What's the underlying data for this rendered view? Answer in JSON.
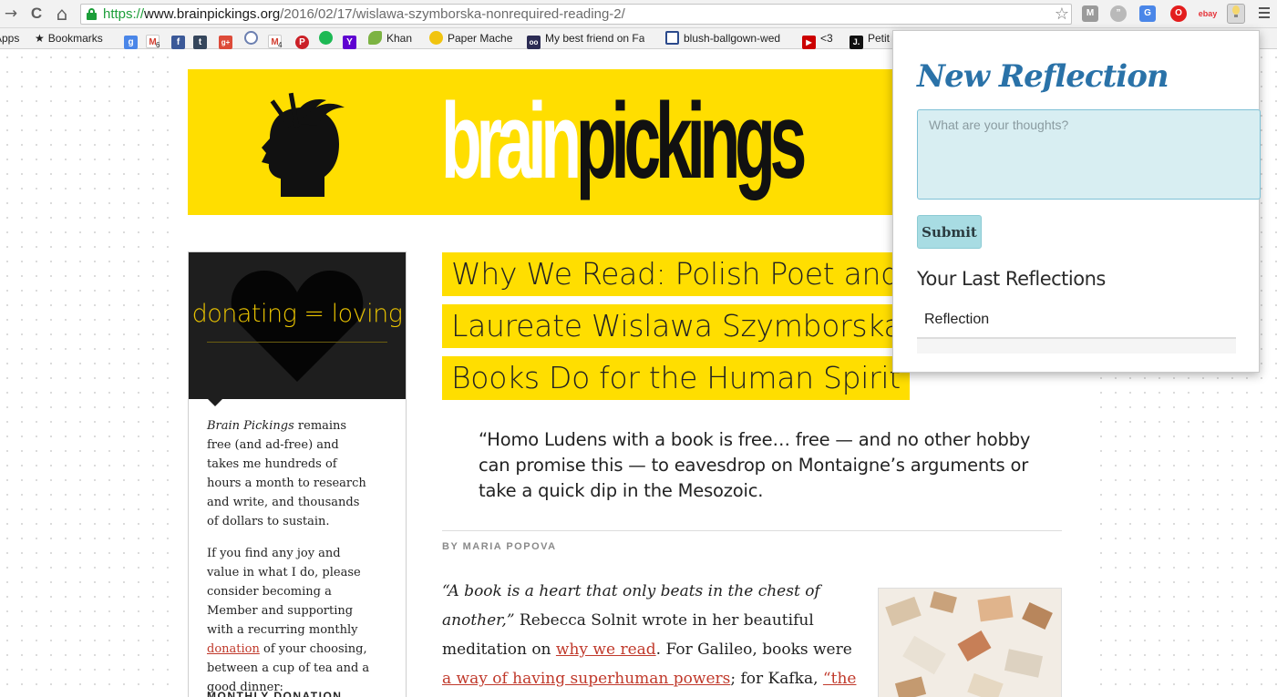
{
  "browser": {
    "url_scheme": "https://",
    "url_host": "www.brainpickings.org",
    "url_path": "/2016/02/17/wislawa-szymborska-nonrequired-reading-2/",
    "nav": {
      "forward": "→",
      "reload": "C",
      "home": "⌂"
    },
    "star": "☆"
  },
  "bookmarks": {
    "apps": "Apps",
    "items": [
      {
        "label": "Bookmarks"
      },
      {
        "label": "Khan"
      },
      {
        "label": "Paper Mache"
      },
      {
        "label": "My best friend on Fa"
      },
      {
        "label": "blush-ballgown-wed"
      },
      {
        "label": "<3"
      },
      {
        "label": "Petit"
      }
    ],
    "badges": {
      "gmail_count": "6",
      "gmail2_count": "4"
    },
    "icon_letters": {
      "google": "g",
      "facebook": "f",
      "tumblr": "t",
      "googleplus": "g+",
      "yahoo": "Y",
      "khan": "",
      "oo": "oo",
      "youtube": "▶",
      "j": "J."
    }
  },
  "banner": {
    "word_brain": "brain",
    "word_pickings": "pickings"
  },
  "donate": {
    "heading": "donating = loving",
    "para1_em": "Brain Pickings",
    "para1_rest": " remains free (and ad-free) and takes me hundreds of hours a month to research and write, and thousands of dollars to sustain.",
    "para2_before": "If you find any joy and value in what I do, please consider becoming a Member and supporting with a recurring monthly ",
    "para2_link": "donation",
    "para2_after": " of your choosing, between a cup of tea and a good dinner:",
    "monthly_label": "MONTHLY DONATION"
  },
  "article": {
    "title_lines": [
      "Why We Read: Polish Poet and",
      "Laureate Wislawa Szymborska",
      "Books Do for the Human Spirit"
    ],
    "pull_quote": "“Homo Ludens with a book is free… free — and no other hobby can promise this — to eavesdrop on Montaigne’s arguments or take a quick dip in the Mesozoic.",
    "byline": "BY MARIA POPOVA",
    "body_em": "“A book is a heart that only beats in the chest of another,”",
    "body_1": " Rebecca Solnit wrote in her beautiful meditation on ",
    "link_1": "why we read",
    "body_2": ". For Galileo, books were ",
    "link_2": "a way of having superhuman powers",
    "body_3": "; for Kafka, ",
    "link_3": "“the axe for the frozen"
  },
  "popup": {
    "title": "New Reflection",
    "textarea_placeholder": "What are your thoughts?",
    "submit_label": "Submit",
    "last_title": "Your Last Reflections",
    "table_header": "Reflection"
  },
  "colors": {
    "brand_yellow": "#ffde00",
    "link_red": "#c0392b",
    "popup_title_blue": "#2a72a8",
    "textarea_bg": "#d8eef2"
  }
}
